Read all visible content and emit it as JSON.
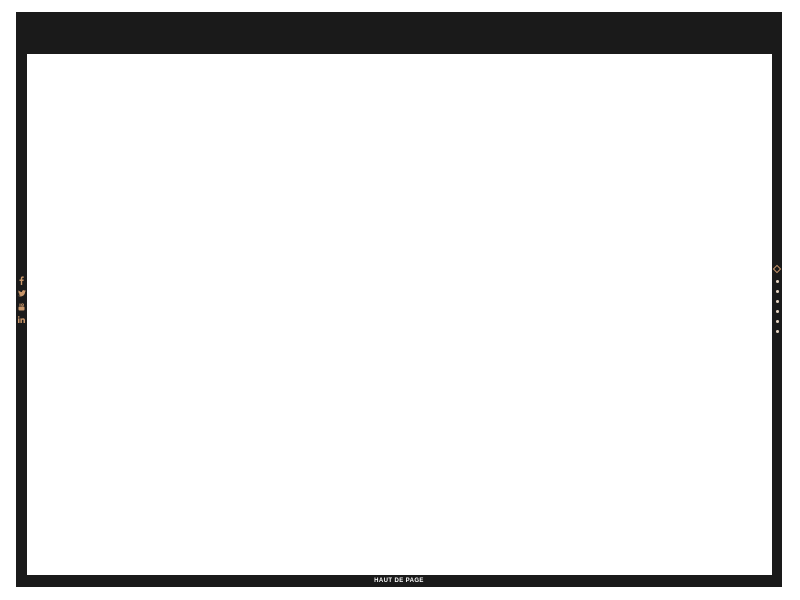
{
  "colors": {
    "frame": "#1a1a1a",
    "accent": "#c8966a",
    "content_bg": "#ffffff",
    "dot": "#e6d5c3"
  },
  "social_links": [
    {
      "name": "facebook-icon"
    },
    {
      "name": "twitter-icon"
    },
    {
      "name": "youtube-icon"
    },
    {
      "name": "linkedin-icon"
    }
  ],
  "section_nav": {
    "active_index": 0,
    "count": 7
  },
  "footer": {
    "back_to_top_label": "HAUT DE PAGE"
  }
}
